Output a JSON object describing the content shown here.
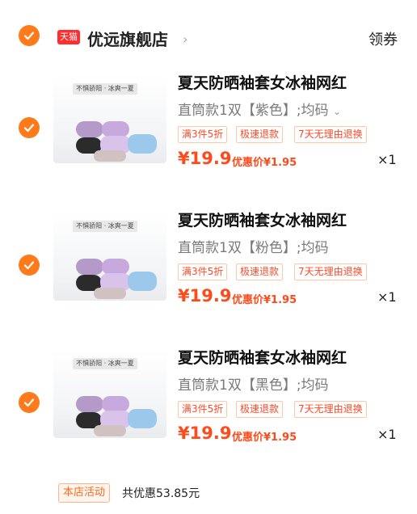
{
  "shop": {
    "badge": "天猫",
    "name": "优远旗舰店",
    "arrow": "›",
    "coupon": "领券"
  },
  "items": [
    {
      "title": "夏天防晒袖套女冰袖网红",
      "variant": "直筒款1双【紫色】;均码",
      "tags": [
        "满3件5折",
        "极速退款",
        "7天无理由退换"
      ],
      "price": "¥19.9",
      "discount": "优惠价¥1.95",
      "qty": "×1",
      "thumb_banner": "不惧骄阳 · 冰爽一夏"
    },
    {
      "title": "夏天防晒袖套女冰袖网红",
      "variant": "直筒款1双【粉色】;均码",
      "tags": [
        "满3件5折",
        "极速退款",
        "7天无理由退换"
      ],
      "price": "¥19.9",
      "discount": "优惠价¥1.95",
      "qty": "×1",
      "thumb_banner": "不惧骄阳 · 冰爽一夏"
    },
    {
      "title": "夏天防晒袖套女冰袖网红",
      "variant": "直筒款1双【黑色】;均码",
      "tags": [
        "满3件5折",
        "极速退款",
        "7天无理由退换"
      ],
      "price": "¥19.9",
      "discount": "优惠价¥1.95",
      "qty": "×1",
      "thumb_banner": "不惧骄阳 · 冰爽一夏"
    }
  ],
  "footer": {
    "badge": "本店活动",
    "text": "共优惠53.85元"
  },
  "colors": {
    "accent": "#ff7a1a",
    "price": "#ff4a1a",
    "tmall": "#ff2d2d"
  }
}
